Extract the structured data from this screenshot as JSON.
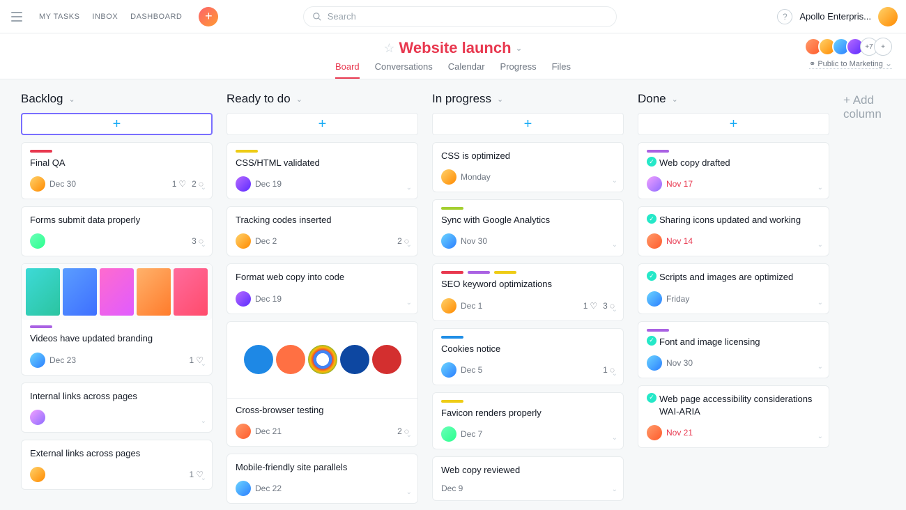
{
  "topbar": {
    "links": [
      "MY TASKS",
      "INBOX",
      "DASHBOARD"
    ],
    "search_placeholder": "Search",
    "workspace": "Apollo Enterpris..."
  },
  "project": {
    "title": "Website launch",
    "tabs": [
      "Board",
      "Conversations",
      "Calendar",
      "Progress",
      "Files"
    ],
    "active_tab": "Board",
    "more_members": "+7",
    "privacy": "Public to Marketing"
  },
  "add_column_label": "+ Add column",
  "columns": [
    {
      "title": "Backlog",
      "add_focused": true,
      "cards": [
        {
          "tags": [
            "#e8384f"
          ],
          "title": "Final QA",
          "avatar": "av-b",
          "due": "Dec 30",
          "likes": 1,
          "comments": 2
        },
        {
          "title": "Forms submit data properly",
          "avatar": "av-f",
          "comments": 3
        },
        {
          "has_gradients": true,
          "tags": [
            "#aa62e3"
          ],
          "title": "Videos have updated branding",
          "avatar": "av-c",
          "due": "Dec 23",
          "likes": 1
        },
        {
          "title": "Internal links across pages",
          "avatar": "av-a"
        },
        {
          "title": "External links across pages",
          "avatar": "av-b",
          "likes": 1
        }
      ]
    },
    {
      "title": "Ready to do",
      "cards": [
        {
          "tags": [
            "#eecc16"
          ],
          "title": "CSS/HTML validated",
          "avatar": "av-d",
          "due": "Dec 19"
        },
        {
          "title": "Tracking codes inserted",
          "avatar": "av-b",
          "due": "Dec 2",
          "comments": 2
        },
        {
          "title": "Format web copy into code",
          "avatar": "av-d",
          "due": "Dec 19"
        },
        {
          "has_browsers": true,
          "title": "Cross-browser testing",
          "avatar": "av-e",
          "due": "Dec 21",
          "comments": 2
        },
        {
          "title": "Mobile-friendly site parallels",
          "avatar": "av-c",
          "due": "Dec 22"
        }
      ]
    },
    {
      "title": "In progress",
      "cards": [
        {
          "title": "CSS is optimized",
          "avatar": "av-b",
          "due": "Monday"
        },
        {
          "tags": [
            "#a4cf30"
          ],
          "title": "Sync with Google Analytics",
          "avatar": "av-c",
          "due": "Nov 30"
        },
        {
          "tags": [
            "#e8384f",
            "#aa62e3",
            "#eecc16"
          ],
          "title": "SEO keyword optimizations",
          "avatar": "av-b",
          "due": "Dec 1",
          "likes": 1,
          "comments": 3
        },
        {
          "tags": [
            "#208ee6"
          ],
          "title": "Cookies notice",
          "avatar": "av-c",
          "due": "Dec 5",
          "comments": 1
        },
        {
          "tags": [
            "#eecc16"
          ],
          "title": "Favicon renders properly",
          "avatar": "av-f",
          "due": "Dec 7"
        },
        {
          "title": "Web copy reviewed",
          "due": "Dec 9"
        }
      ]
    },
    {
      "title": "Done",
      "cards": [
        {
          "tags": [
            "#aa62e3"
          ],
          "done": true,
          "title": "Web copy drafted",
          "avatar": "av-a",
          "due": "Nov 17",
          "overdue": true
        },
        {
          "done": true,
          "title": "Sharing icons updated and working",
          "avatar": "av-e",
          "due": "Nov 14",
          "overdue": true
        },
        {
          "done": true,
          "title": "Scripts and images are optimized",
          "avatar": "av-c",
          "due": "Friday"
        },
        {
          "tags": [
            "#aa62e3"
          ],
          "done": true,
          "title": "Font and image licensing",
          "avatar": "av-c",
          "due": "Nov 30"
        },
        {
          "done": true,
          "title": "Web page accessibility considerations WAI-ARIA",
          "avatar": "av-e",
          "due": "Nov 21",
          "overdue": true
        }
      ]
    }
  ]
}
